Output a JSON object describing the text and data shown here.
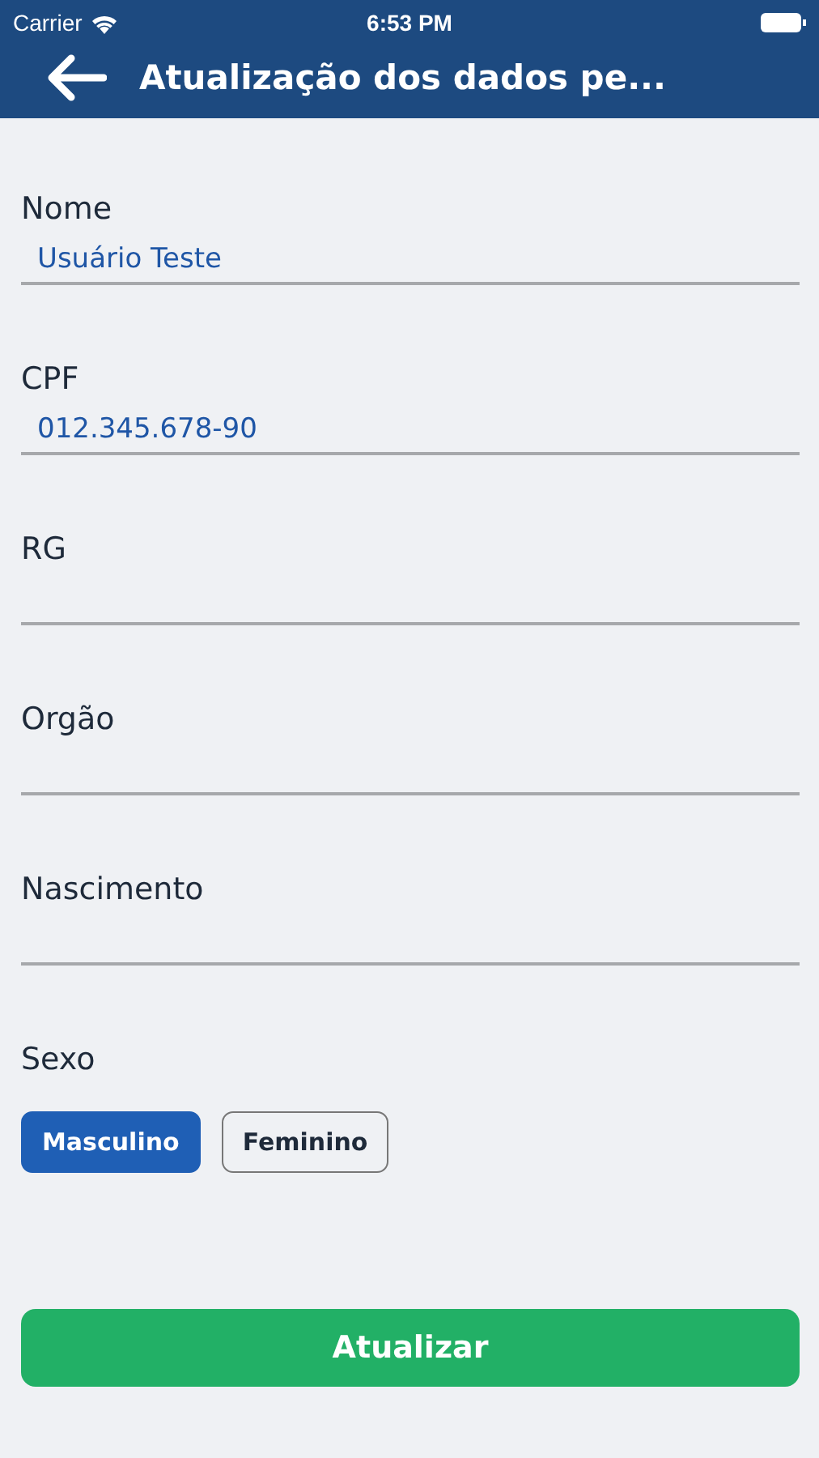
{
  "status_bar": {
    "carrier": "Carrier",
    "time": "6:53 PM"
  },
  "header": {
    "title": "Atualização dos dados pe..."
  },
  "fields": [
    {
      "label": "Nome",
      "value": "Usuário Teste"
    },
    {
      "label": "CPF",
      "value": "012.345.678-90"
    },
    {
      "label": "RG"
    },
    {
      "label": "Orgão"
    },
    {
      "label": "Nascimento"
    }
  ],
  "sex": {
    "label": "Sexo",
    "options": [
      {
        "label": "Masculino",
        "selected": true
      },
      {
        "label": "Feminino",
        "selected": false
      }
    ]
  },
  "submit_button": {
    "label": "Atualizar"
  }
}
